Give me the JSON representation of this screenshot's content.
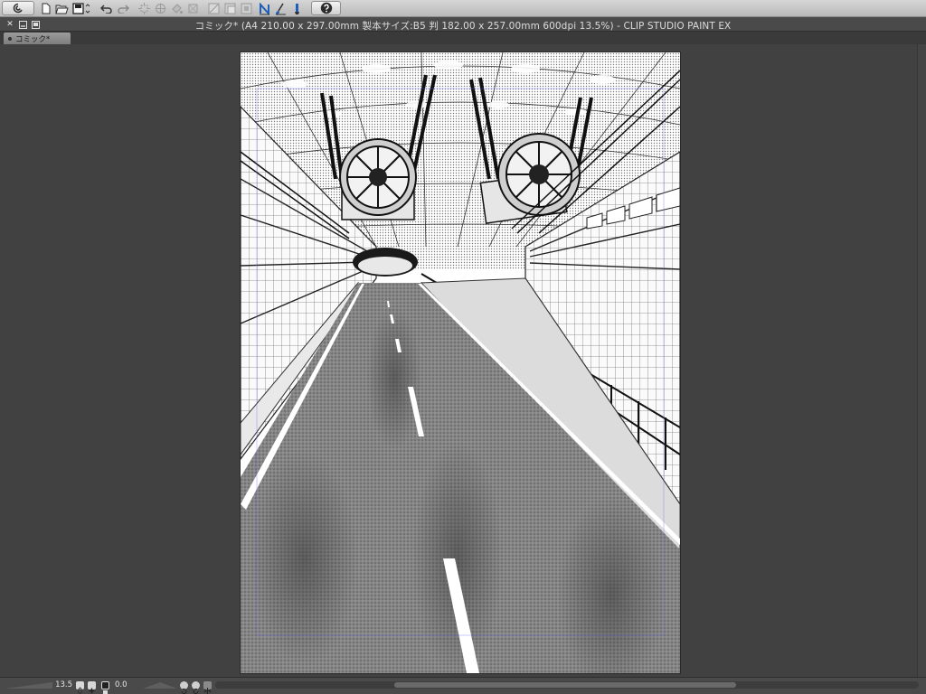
{
  "app": {
    "name": "CLIP STUDIO PAINT EX",
    "window_title": "コミック* (A4 210.00 x 297.00mm 製本サイズ:B5 判 182.00 x 257.00mm 600dpi 13.5%)  - CLIP STUDIO PAINT EX"
  },
  "toolbar": {
    "icons": [
      "clip-studio-logo-icon",
      "new-file-icon",
      "open-file-icon",
      "save-icon",
      "undo-icon",
      "redo-icon",
      "transform-icon",
      "move-icon",
      "fill-icon",
      "crop-icon",
      "ruler-icon",
      "layer-icon",
      "snap-icon",
      "pen-tool-icon",
      "brush-tool-icon",
      "fill-tool-icon",
      "help-icon"
    ]
  },
  "document_tabs": [
    {
      "label": "コミック*",
      "active": true
    }
  ],
  "canvas": {
    "content": "manga-style tunnel road illustration with two jet fans",
    "colors": {
      "paper": "#ffffff",
      "road": "#7a7a7a",
      "ink": "#111111"
    }
  },
  "statusbar": {
    "zoom": "13.5",
    "rotation": "0.0",
    "horizontal_scroll": 0.42
  },
  "colors": {
    "workspace": "#414141",
    "toolbar": "#c8c8c8",
    "titlebar": "#4a4a4a"
  }
}
